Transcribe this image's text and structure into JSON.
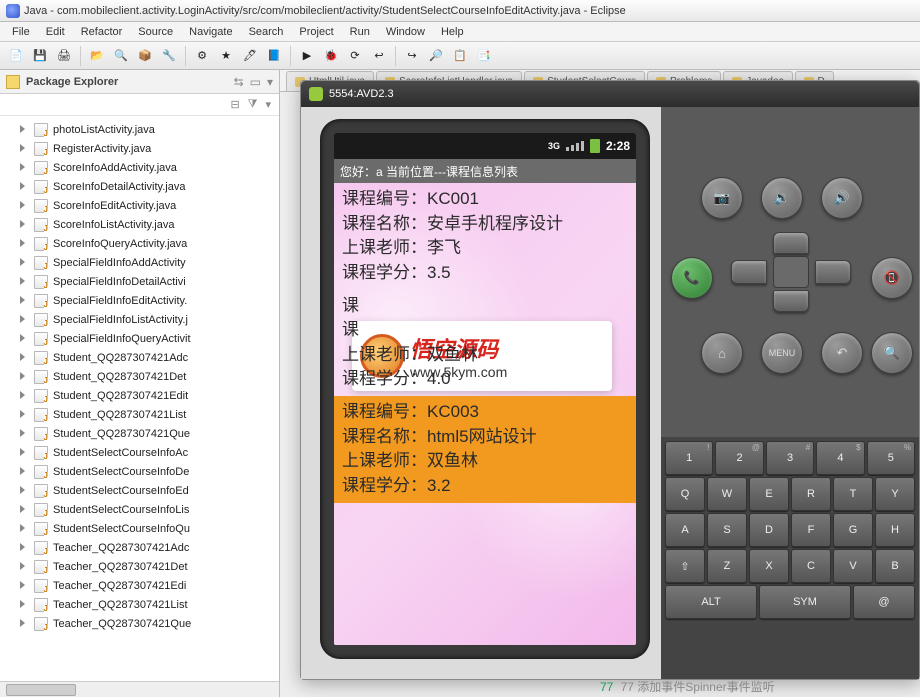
{
  "window": {
    "title": "Java - com.mobileclient.activity.LoginActivity/src/com/mobileclient/activity/StudentSelectCourseInfoEditActivity.java - Eclipse"
  },
  "menu": [
    "File",
    "Edit",
    "Refactor",
    "Source",
    "Navigate",
    "Search",
    "Project",
    "Run",
    "Window",
    "Help"
  ],
  "toolbar_icons": [
    "📄",
    "💾",
    "🖨",
    "📂",
    "🔍",
    "📦",
    "🔧",
    "⚙",
    "★",
    "🖊",
    "📘",
    "▶",
    "🐞",
    "⟳",
    "↩",
    "↪",
    "🔎",
    "📋",
    "📑"
  ],
  "explorer": {
    "title": "Package Explorer",
    "mini_icons": [
      "⇆",
      "▭",
      "⋮"
    ],
    "files": [
      "photoListActivity.java",
      "RegisterActivity.java",
      "ScoreInfoAddActivity.java",
      "ScoreInfoDetailActivity.java",
      "ScoreInfoEditActivity.java",
      "ScoreInfoListActivity.java",
      "ScoreInfoQueryActivity.java",
      "SpecialFieldInfoAddActivity",
      "SpecialFieldInfoDetailActivi",
      "SpecialFieldInfoEditActivity.",
      "SpecialFieldInfoListActivity.j",
      "SpecialFieldInfoQueryActivit",
      "Student_QQ287307421Adc",
      "Student_QQ287307421Det",
      "Student_QQ287307421Edit",
      "Student_QQ287307421List",
      "Student_QQ287307421Que",
      "StudentSelectCourseInfoAc",
      "StudentSelectCourseInfoDe",
      "StudentSelectCourseInfoEd",
      "StudentSelectCourseInfoLis",
      "StudentSelectCourseInfoQu",
      "Teacher_QQ287307421Adc",
      "Teacher_QQ287307421Det",
      "Teacher_QQ287307421Edi",
      "Teacher_QQ287307421List",
      "Teacher_QQ287307421Que"
    ]
  },
  "editor_tabs": [
    "HtmlUtil.java",
    "ScoreInfoListHandler.java",
    "StudentSelectCours",
    "Problems",
    "Javadoc",
    "D"
  ],
  "emulator": {
    "title": "5554:AVD2.3",
    "status_time": "2:28",
    "appbar": "您好：a  当前位置---课程信息列表",
    "labels": {
      "course_no": "课程编号：",
      "course_name": "课程名称：",
      "teacher": "上课老师：",
      "credit": "课程学分："
    },
    "courses": [
      {
        "no": "KC001",
        "name": "安卓手机程序设计",
        "teacher": "李飞",
        "credit": "3.5",
        "selected": false,
        "partial": false
      },
      {
        "no": "",
        "name": "",
        "teacher": "双鱼林",
        "credit": "4.0",
        "selected": false,
        "partial": true
      },
      {
        "no": "KC003",
        "name": "html5网站设计",
        "teacher": "双鱼林",
        "credit": "3.2",
        "selected": true,
        "partial": false
      }
    ],
    "watermark": {
      "title": "悟空源码",
      "url": "www.5kym.com"
    },
    "buttons": {
      "camera": "📷",
      "vol_up": "🔊",
      "vol_down": "🔉",
      "call": "📞",
      "end": "📵",
      "home": "⌂",
      "menu": "MENU",
      "back": "↶",
      "search": "🔍"
    },
    "keyboard": {
      "row1": [
        {
          "k": "1",
          "s": "!"
        },
        {
          "k": "2",
          "s": "@"
        },
        {
          "k": "3",
          "s": "#"
        },
        {
          "k": "4",
          "s": "$"
        },
        {
          "k": "5",
          "s": "%"
        }
      ],
      "row2": [
        {
          "k": "Q"
        },
        {
          "k": "W"
        },
        {
          "k": "E"
        },
        {
          "k": "R"
        },
        {
          "k": "T"
        },
        {
          "k": "Y"
        }
      ],
      "row3": [
        {
          "k": "A"
        },
        {
          "k": "S"
        },
        {
          "k": "D"
        },
        {
          "k": "F"
        },
        {
          "k": "G"
        },
        {
          "k": "H"
        }
      ],
      "row4": [
        {
          "k": "⇧"
        },
        {
          "k": "Z"
        },
        {
          "k": "X"
        },
        {
          "k": "C"
        },
        {
          "k": "V"
        },
        {
          "k": "B"
        }
      ],
      "row5": [
        {
          "k": "ALT"
        },
        {
          "k": "SYM"
        },
        {
          "k": "@"
        }
      ]
    }
  },
  "footer_code": "77 添加事件Spinner事件监听"
}
